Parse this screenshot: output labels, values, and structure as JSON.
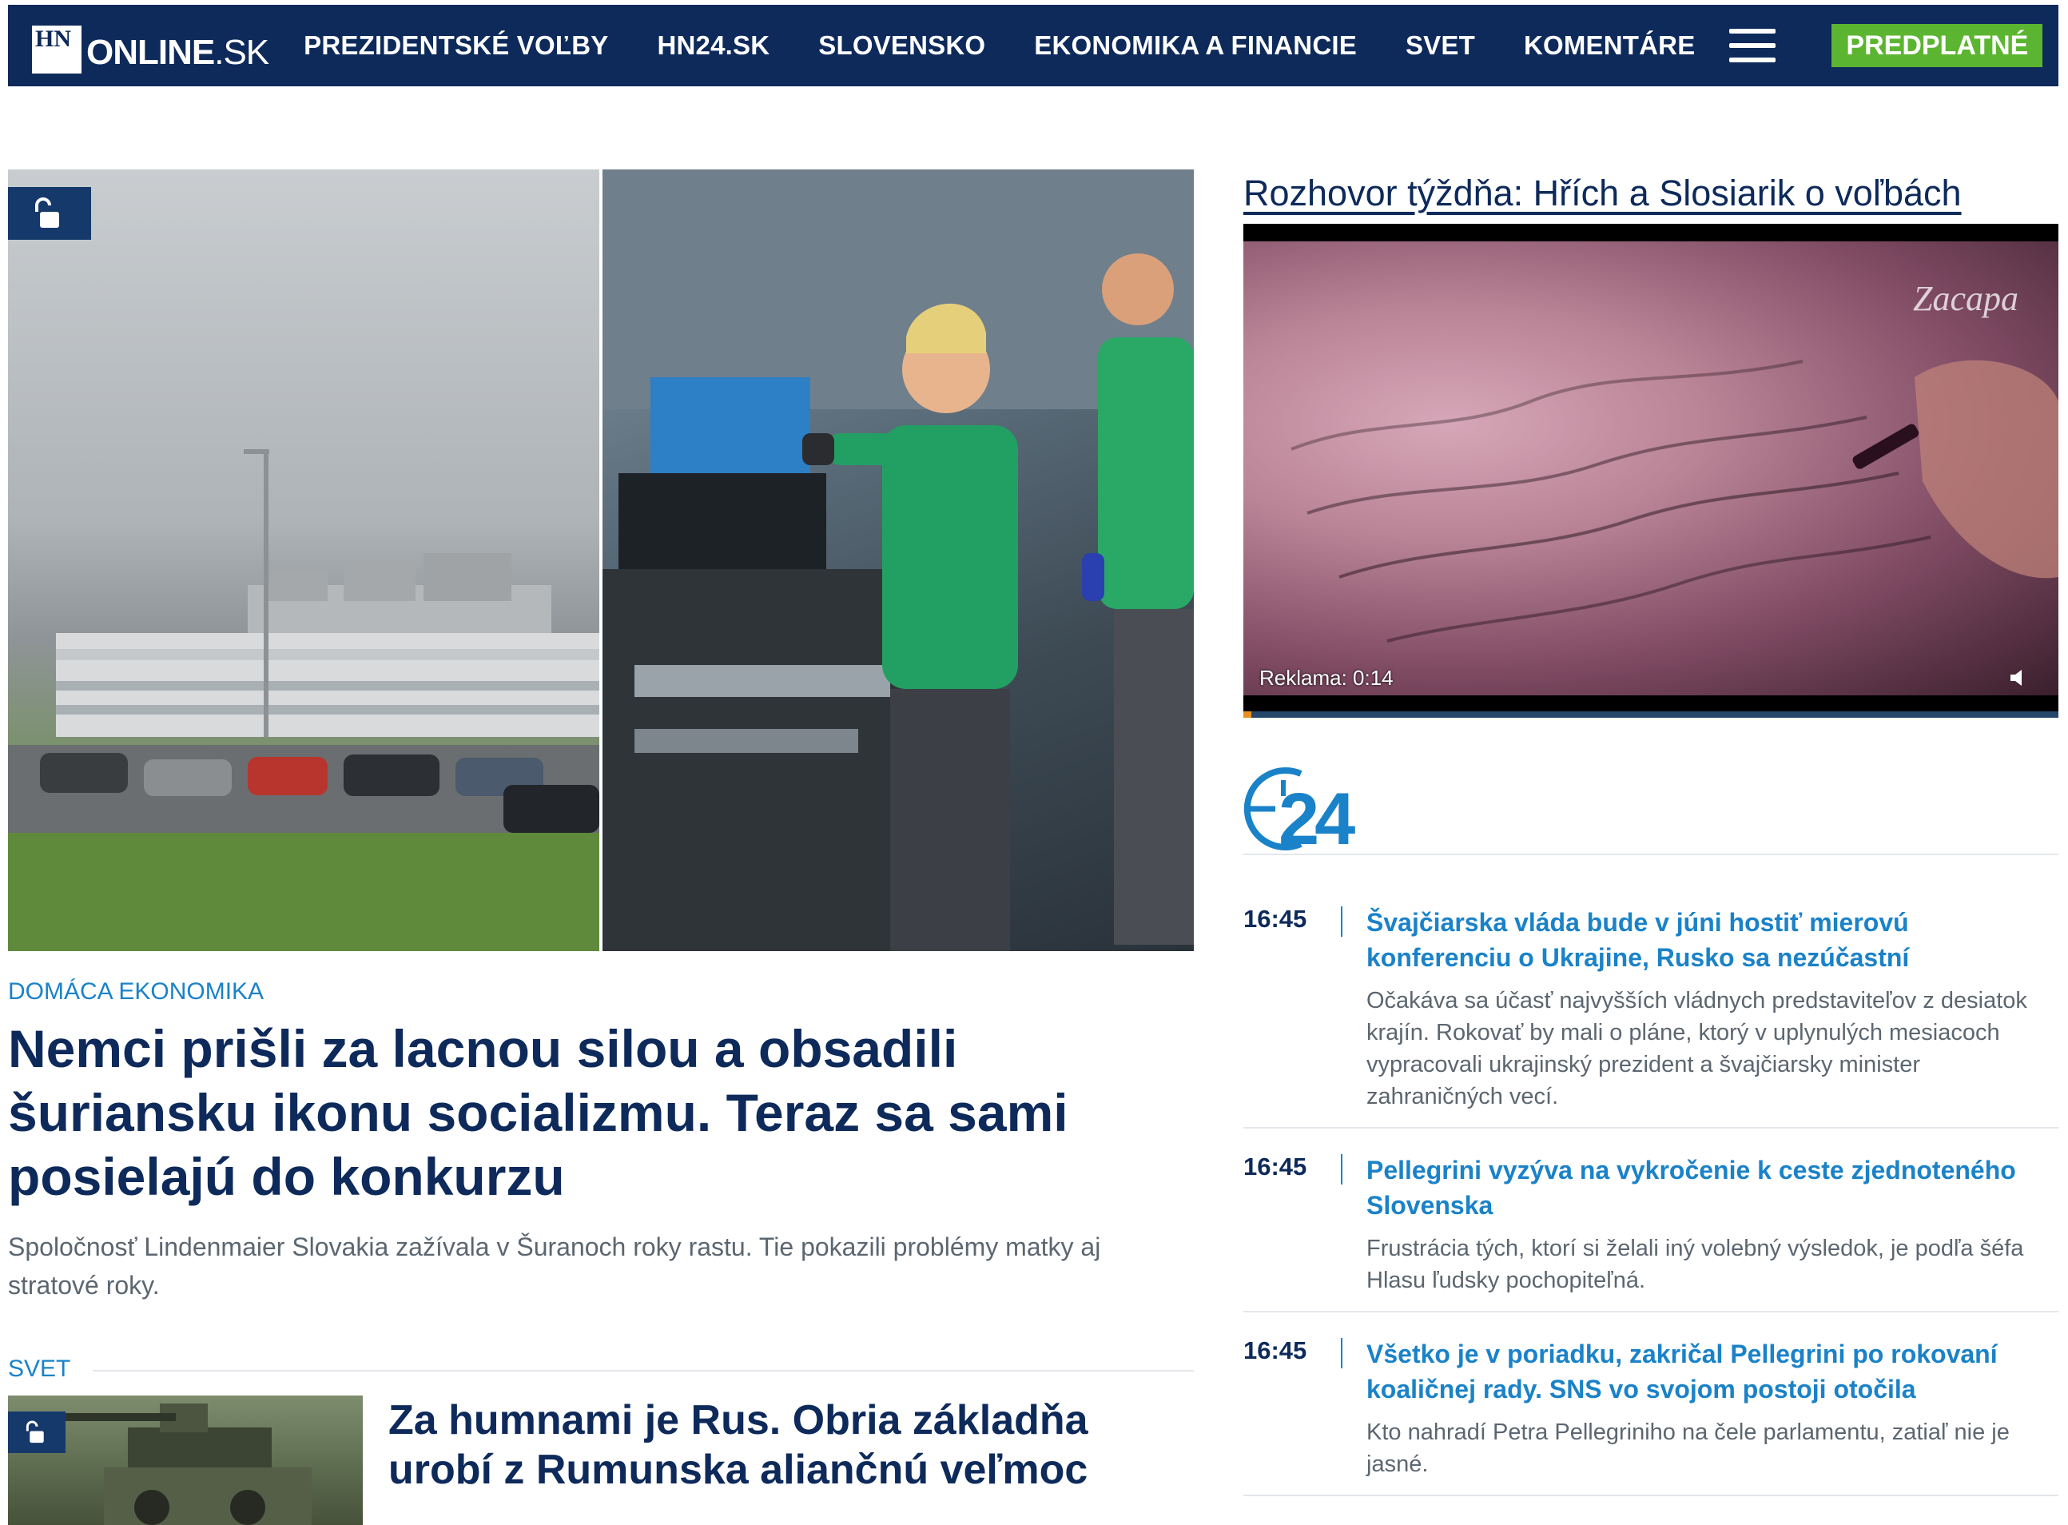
{
  "header": {
    "logo_hn": "HN",
    "logo_online": "ONLINE",
    "logo_sk": ".SK",
    "nav": [
      "PREZIDENTSKÉ VOĽBY",
      "HN24.SK",
      "SLOVENSKO",
      "EKONOMIKA A FINANCIE",
      "SVET",
      "KOMENTÁRE"
    ],
    "subscribe_label": "PREDPLATNÉ",
    "icons": [
      "menu-icon",
      "search-icon",
      "user-icon"
    ]
  },
  "hero": {
    "category": "DOMÁCA EKONOMIKA",
    "title": "Nemci prišli za lacnou silou a obsadili šuriansku ikonu socializmu. Teraz sa sami posielajú do konkurzu",
    "perex": "Spoločnosť Lindenmaier Slovakia zažívala v Šuranoch roky rastu. Tie pokazili problémy matky aj stratové roky."
  },
  "second": {
    "section": "SVET",
    "title": "Za humnami je Rus. Obria základňa urobí z Rumunska aliančnú veľmoc"
  },
  "video": {
    "title": "Rozhovor týždňa: Hřích a Slosiarik o voľbách",
    "brand": "Zacapa",
    "ad_label": "Reklama: 0:14",
    "progress": 0.01
  },
  "hn24": {
    "logo_text": "24",
    "items": [
      {
        "time": "16:45",
        "headline": "Švajčiarska vláda bude v júni hostiť mierovú konferenciu o Ukrajine, Rusko sa nezúčastní",
        "summary": "Očakáva sa účasť najvyšších vládnych predstaviteľov z desiatok krajín. Rokovať by mali o pláne, ktorý v uplynulých mesiacoch vypracovali ukrajinský prezident a švajčiarsky minister zahraničných vecí."
      },
      {
        "time": "16:45",
        "headline": "Pellegrini vyzýva na vykročenie k ceste zjednoteného Slovenska",
        "summary": "Frustrácia tých, ktorí si želali iný volebný výsledok, je podľa šéfa Hlasu ľudsky pochopiteľná."
      },
      {
        "time": "16:45",
        "headline": "Všetko je v poriadku, zakričal Pellegrini po rokovaní koaličnej rady. SNS vo svojom postoji otočila",
        "summary": "Kto nahradí Petra Pellegriniho na čele parlamentu, zatiaľ nie je jasné."
      }
    ]
  },
  "colors": {
    "navy": "#0e2a5b",
    "accent_blue": "#1a82c8",
    "subscribe_green": "#5cb531"
  }
}
